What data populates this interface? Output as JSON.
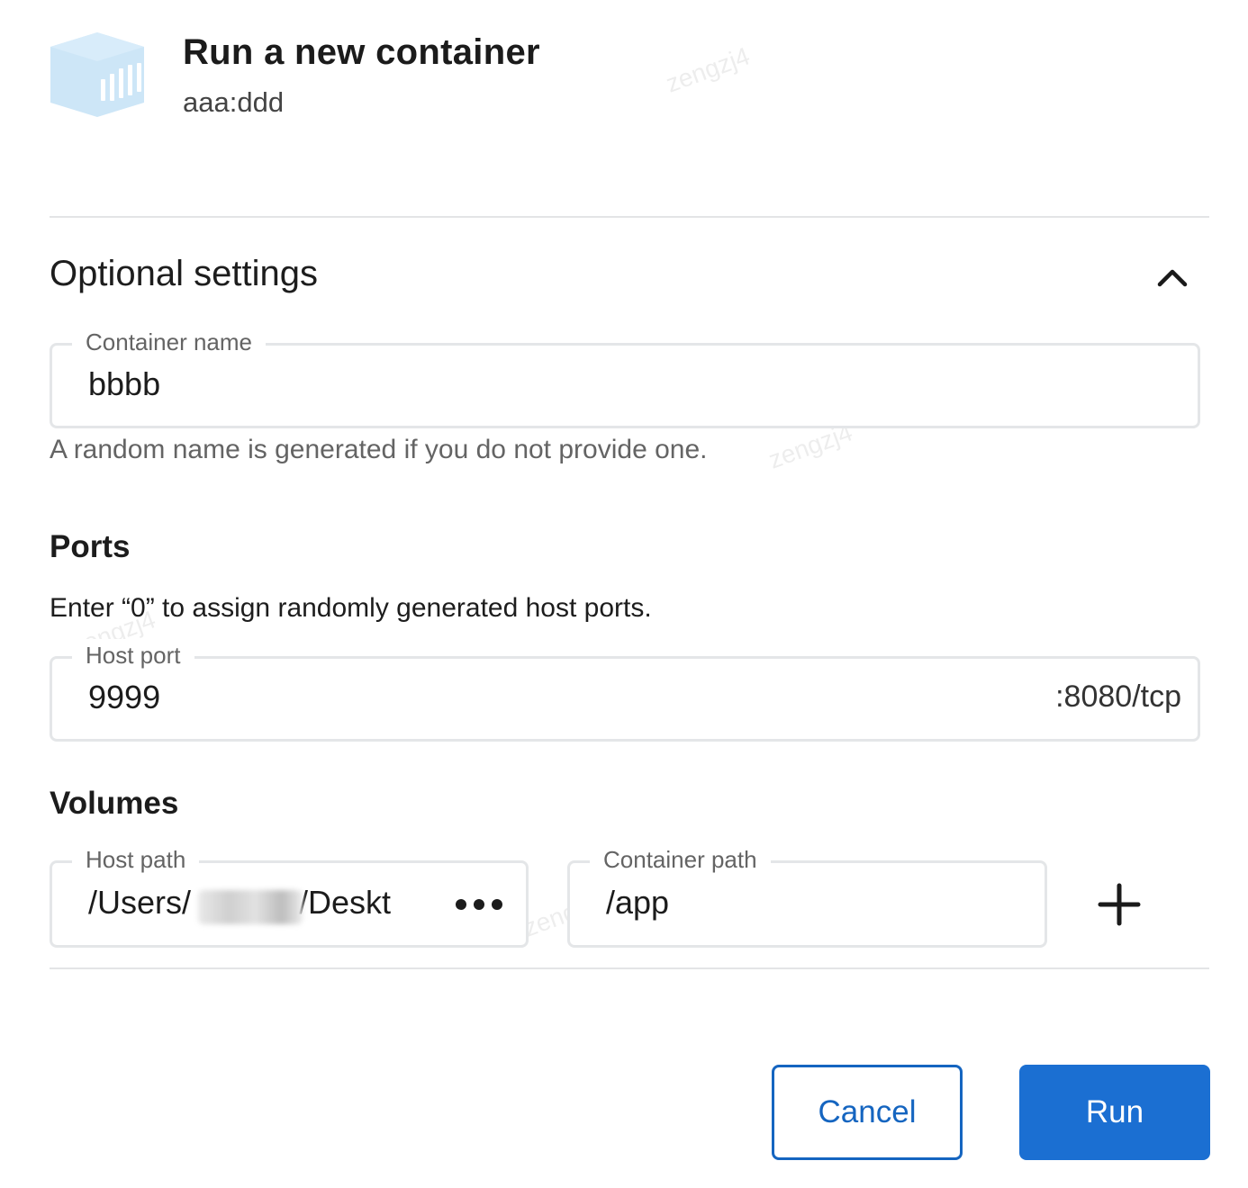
{
  "header": {
    "title": "Run a new container",
    "image": "aaa:ddd",
    "icon": "container-icon"
  },
  "optional_settings": {
    "title": "Optional settings",
    "expanded": true,
    "collapse_icon": "chevron-up-icon"
  },
  "container_name": {
    "label": "Container name",
    "value": "bbbb",
    "helper": "A random name is generated if you do not provide one."
  },
  "ports": {
    "heading": "Ports",
    "description": "Enter “0” to assign randomly generated host ports.",
    "host_port": {
      "label": "Host port",
      "value": "9999",
      "container_port": ":8080/tcp"
    }
  },
  "volumes": {
    "heading": "Volumes",
    "host_path": {
      "label": "Host path",
      "value_prefix": "/Users/",
      "value_suffix": "/Deskt",
      "more_icon": "more-horizontal-icon"
    },
    "container_path": {
      "label": "Container path",
      "value": "/app"
    },
    "add_icon": "plus-icon"
  },
  "actions": {
    "cancel": "Cancel",
    "run": "Run"
  },
  "colors": {
    "primary": "#1b6fd2",
    "cancel_border": "#1565c0",
    "icon_fill": "#cde6f7"
  },
  "watermark": "zengzj4"
}
